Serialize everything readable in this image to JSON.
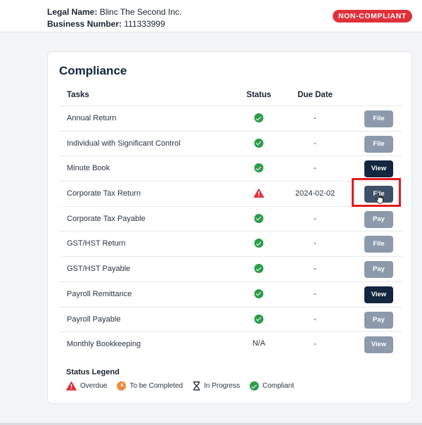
{
  "header": {
    "legal_name_label": "Legal Name:",
    "legal_name": "Blinc The Second Inc.",
    "business_number_label": "Business Number:",
    "business_number": "111333999",
    "status_badge": "NON-COMPLIANT",
    "badge_color": "#e0303a"
  },
  "compliance": {
    "title": "Compliance",
    "columns": {
      "tasks": "Tasks",
      "status": "Status",
      "due_date": "Due Date"
    },
    "rows": [
      {
        "task": "Annual Return",
        "status": "compliant",
        "due": "-",
        "action": "File",
        "action_style": "muted"
      },
      {
        "task": "Individual with Significant Control",
        "status": "compliant",
        "due": "-",
        "action": "File",
        "action_style": "muted"
      },
      {
        "task": "Minute Book",
        "status": "compliant",
        "due": "-",
        "action": "View",
        "action_style": "dark"
      },
      {
        "task": "Corporate Tax Return",
        "status": "overdue",
        "due": "2024-02-02",
        "action": "File",
        "action_style": "hover"
      },
      {
        "task": "Corporate Tax Payable",
        "status": "compliant",
        "due": "-",
        "action": "Pay",
        "action_style": "muted"
      },
      {
        "task": "GST/HST Return",
        "status": "compliant",
        "due": "-",
        "action": "File",
        "action_style": "muted"
      },
      {
        "task": "GST/HST Payable",
        "status": "compliant",
        "due": "-",
        "action": "Pay",
        "action_style": "muted"
      },
      {
        "task": "Payroll Remittance",
        "status": "compliant",
        "due": "-",
        "action": "View",
        "action_style": "dark"
      },
      {
        "task": "Payroll Payable",
        "status": "compliant",
        "due": "-",
        "action": "Pay",
        "action_style": "muted"
      },
      {
        "task": "Monthly Bookkeeping",
        "status": "N/A",
        "due": "-",
        "action": "View",
        "action_style": "muted"
      }
    ]
  },
  "legend": {
    "title": "Status Legend",
    "items": {
      "overdue": "Overdue",
      "to_be_completed": "To be Completed",
      "in_progress": "In Progress",
      "compliant": "Compliant"
    }
  },
  "colors": {
    "compliant": "#2a9d4a",
    "overdue": "#e0303a",
    "to_be_completed": "#f08a3c",
    "button_dark": "#13263f",
    "button_muted": "#8c9aab",
    "highlight": "#e31c1c"
  }
}
